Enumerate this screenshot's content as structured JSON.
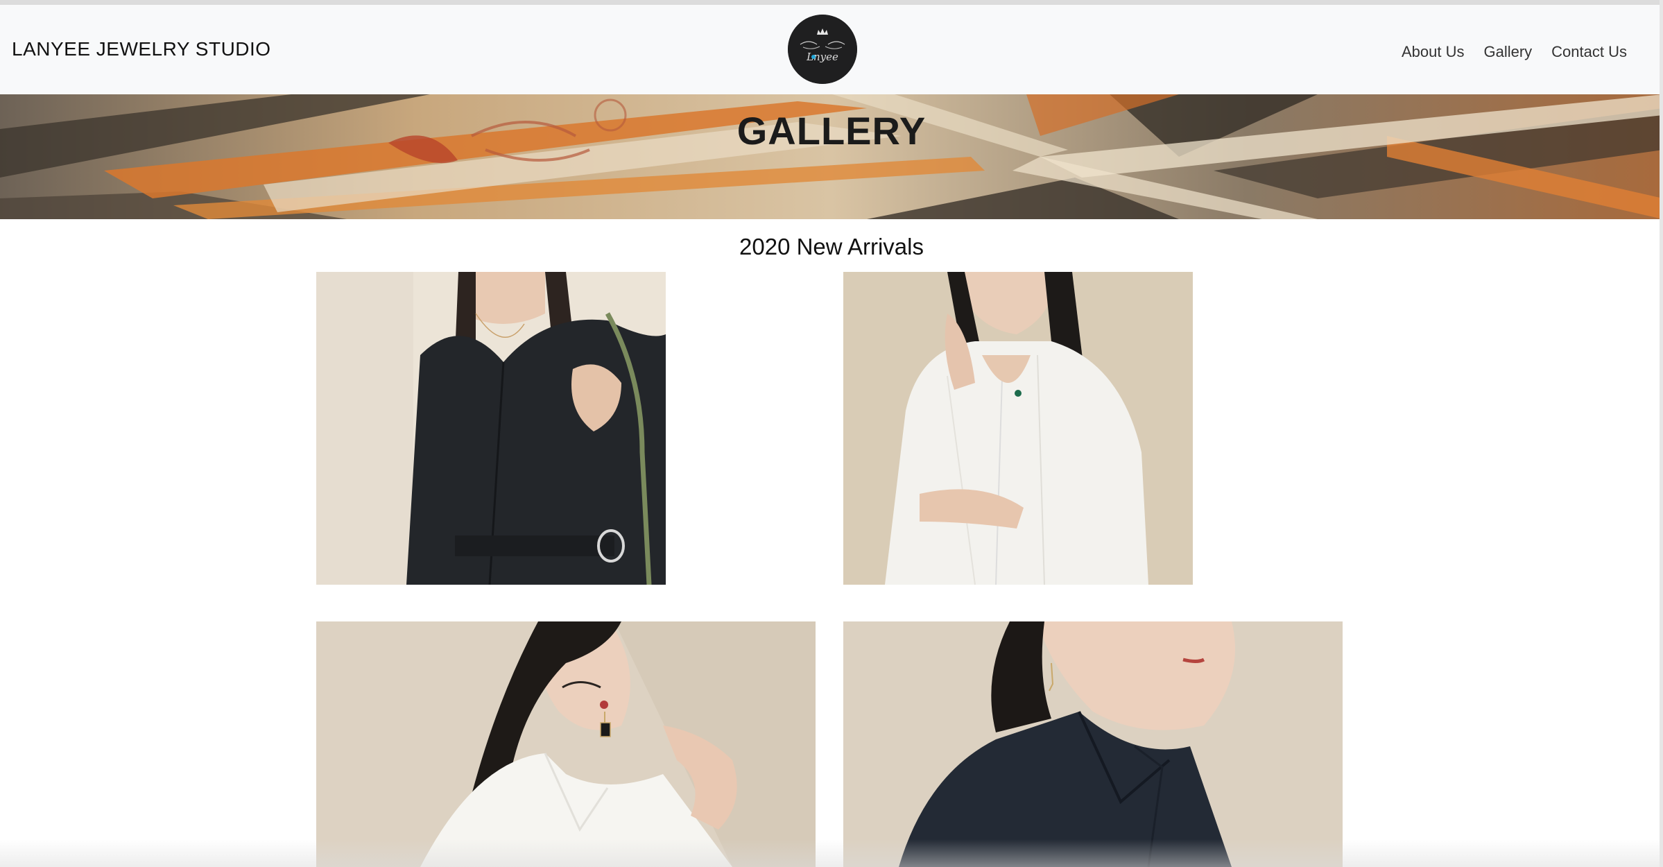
{
  "navbar": {
    "brand": "LANYEE JEWELRY STUDIO",
    "logo_icon": "lanyee-crown-logo",
    "links": [
      "About Us",
      "Gallery",
      "Contact Us"
    ]
  },
  "banner": {
    "title": "GALLERY"
  },
  "gallery": {
    "title": "2020 New Arrivals",
    "photos": [
      {
        "desc": "model-black-shirt-dress-necklace"
      },
      {
        "desc": "model-white-pinstripe-blazer-pendant"
      },
      {
        "desc": "model-white-shirt-earring"
      },
      {
        "desc": "model-black-blazer-earring"
      }
    ]
  },
  "colors": {
    "navbar_bg": "#f8f9fa",
    "logo_bg": "#1f1f20",
    "accent_orange": "#d9782e"
  }
}
